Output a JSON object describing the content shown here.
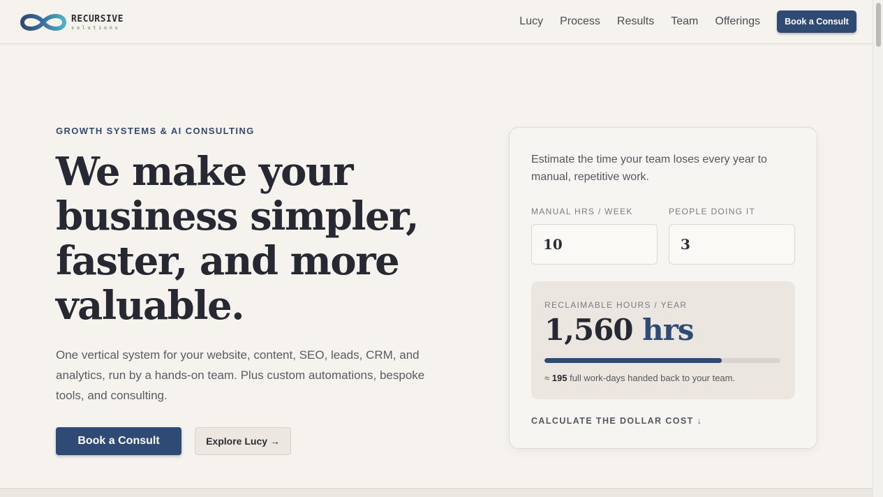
{
  "brand": {
    "name": "RECURSIVE",
    "tagline": "solutions",
    "logo_icon": "infinity-logo",
    "colors": {
      "primary": "#2f4a75",
      "accent": "#3aa0b8",
      "background": "#f6f3ee"
    }
  },
  "nav": {
    "items": [
      {
        "label": "Lucy"
      },
      {
        "label": "Process"
      },
      {
        "label": "Results"
      },
      {
        "label": "Team"
      },
      {
        "label": "Offerings"
      }
    ],
    "cta_label": "Book a Consult"
  },
  "hero": {
    "eyebrow": "GROWTH SYSTEMS & AI CONSULTING",
    "headline": "We make your business simpler, faster, and more valuable.",
    "subtext": "One vertical system for your website, content, SEO, leads, CRM, and analytics, run by a hands-on team. Plus custom automations, bespoke tools, and consulting.",
    "primary_button": "Book a Consult",
    "secondary_button": "Explore Lucy →"
  },
  "calculator": {
    "intro": "Estimate the time your team loses every year to manual, repetitive work.",
    "hours_label": "MANUAL HRS / WEEK",
    "hours_value": "10",
    "people_label": "PEOPLE DOING IT",
    "people_value": "3",
    "result_label": "RECLAIMABLE HOURS / YEAR",
    "result_number": "1,560",
    "result_unit": "hrs",
    "progress_fraction": 0.75,
    "note_prefix": "≈",
    "note_days": "195",
    "note_suffix": "full work-days handed back to your team.",
    "dollar_link": "CALCULATE THE DOLLAR COST ↓"
  }
}
